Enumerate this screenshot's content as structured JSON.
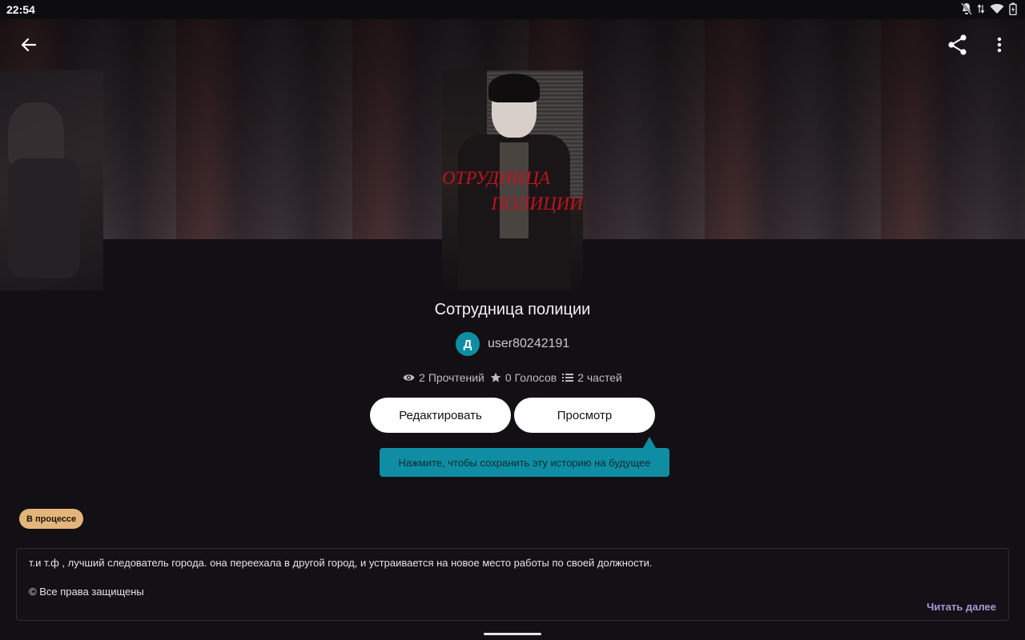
{
  "status_bar": {
    "time": "22:54",
    "icons": [
      "notifications-off-icon",
      "data-arrows-icon",
      "wifi-icon",
      "battery-icon"
    ]
  },
  "toolbar": {
    "back_icon": "arrow-left-icon",
    "share_icon": "share-icon",
    "more_icon": "more-vertical-icon"
  },
  "cover": {
    "title_line1": "ОТРУДНИЦА",
    "title_line2": "ПОЛИЦИИ"
  },
  "story": {
    "title": "Сотрудница полиции",
    "author_initial": "Д",
    "author": "user80242191",
    "stats": {
      "reads": "2 Прочтений",
      "votes": "0 Голосов",
      "parts": "2 частей"
    },
    "status": "В процессе",
    "description": "т.и т.ф , лучший следователь города. она переехала в другой город, и устраивается на новое место работы по своей должности.",
    "copyright": "© Все права защищены"
  },
  "actions": {
    "edit_label": "Редактировать",
    "view_label": "Просмотр",
    "read_more": "Читать далее"
  },
  "tooltip": {
    "text": "Нажмите, чтобы сохранить эту историю на будущее"
  },
  "colors": {
    "accent_teal": "#0f8ea3",
    "badge_gold": "#e4b57a",
    "link_purple": "#a59ad8",
    "background": "#121014"
  }
}
